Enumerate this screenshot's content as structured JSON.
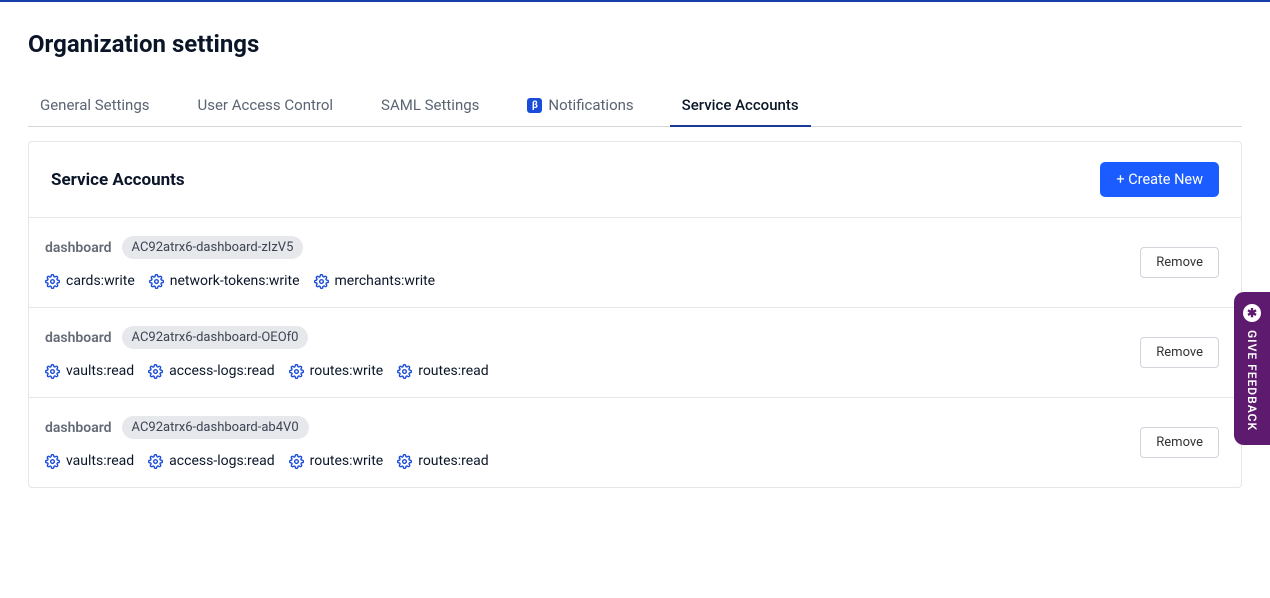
{
  "header": {
    "title": "Organization settings"
  },
  "tabs": [
    {
      "label": "General Settings"
    },
    {
      "label": "User Access Control"
    },
    {
      "label": "SAML Settings"
    },
    {
      "label": "Notifications",
      "beta_badge": "β"
    },
    {
      "label": "Service Accounts",
      "active": true
    }
  ],
  "panel": {
    "title": "Service Accounts",
    "create_label": "+ Create New",
    "remove_label": "Remove"
  },
  "accounts": [
    {
      "name": "dashboard",
      "id": "AC92atrx6-dashboard-zIzV5",
      "scopes": [
        "cards:write",
        "network-tokens:write",
        "merchants:write"
      ]
    },
    {
      "name": "dashboard",
      "id": "AC92atrx6-dashboard-OEOf0",
      "scopes": [
        "vaults:read",
        "access-logs:read",
        "routes:write",
        "routes:read"
      ]
    },
    {
      "name": "dashboard",
      "id": "AC92atrx6-dashboard-ab4V0",
      "scopes": [
        "vaults:read",
        "access-logs:read",
        "routes:write",
        "routes:read"
      ]
    }
  ],
  "feedback": {
    "label": "GIVE FEEDBACK",
    "icon": "✱"
  }
}
